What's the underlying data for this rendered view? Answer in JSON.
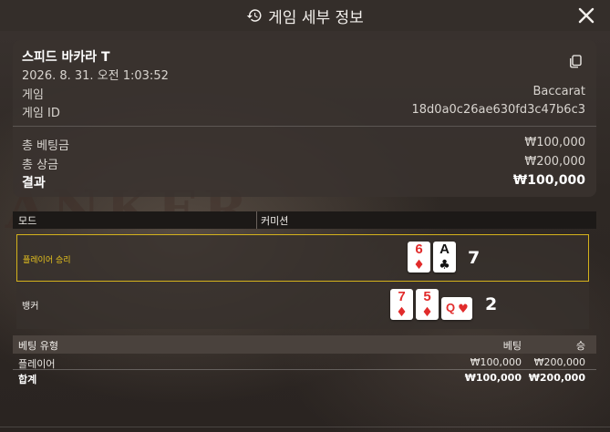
{
  "header": {
    "title": "게임 세부 정보",
    "icon": "history-icon",
    "close_icon": "close-icon"
  },
  "info": {
    "game_name": "스피드 바카라 T",
    "datetime": "2026. 8. 31. 오전 1:03:52",
    "game_label": "게임",
    "game_value": "Baccarat",
    "game_id_label": "게임 ID",
    "game_id_value": "18d0a0c26ae630fd3c47b6c3",
    "total_bet_label": "총 베팅금",
    "total_bet_value": "₩100,000",
    "total_win_label": "총 상금",
    "total_win_value": "₩200,000",
    "result_label": "결과",
    "result_value": "₩100,000"
  },
  "mode": {
    "mode_label": "모드",
    "commission_label": "커미션"
  },
  "outcomes": {
    "player": {
      "label": "플레이어 승리",
      "cards": [
        {
          "rank": "6",
          "suit": "♦",
          "color": "#e12b2b"
        },
        {
          "rank": "A",
          "suit": "♣",
          "color": "#111111"
        }
      ],
      "score": "7"
    },
    "banker": {
      "label": "뱅커",
      "cards": [
        {
          "rank": "7",
          "suit": "♦",
          "color": "#e12b2b"
        },
        {
          "rank": "5",
          "suit": "♦",
          "color": "#e12b2b"
        },
        {
          "rank": "Q",
          "suit": "♥",
          "color": "#e12b2b"
        }
      ],
      "score": "2"
    }
  },
  "bets": {
    "headers": {
      "type": "베팅 유형",
      "bet": "베팅",
      "win": "승"
    },
    "rows": [
      {
        "type": "플레이어",
        "bet": "₩100,000",
        "win": "₩200,000"
      }
    ],
    "total": {
      "type": "합계",
      "bet": "₩100,000",
      "win": "₩200,000"
    }
  },
  "colors": {
    "player_highlight": "#d4b21c",
    "card_red": "#e12b2b"
  }
}
